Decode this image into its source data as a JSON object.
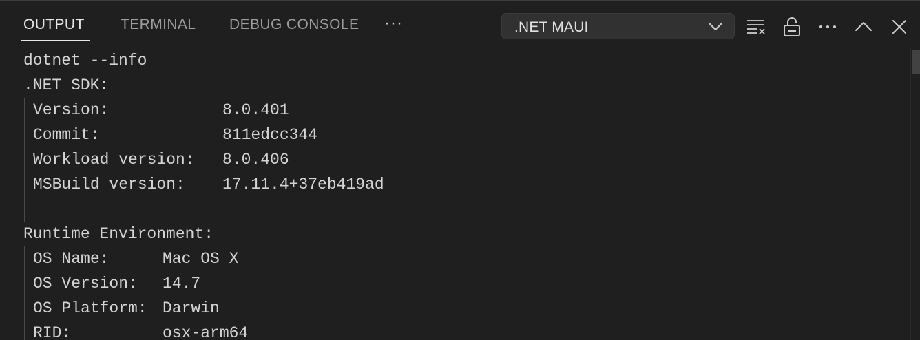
{
  "panel": {
    "tabs": [
      {
        "label": "OUTPUT",
        "active": true
      },
      {
        "label": "TERMINAL",
        "active": false
      },
      {
        "label": "DEBUG CONSOLE",
        "active": false
      }
    ],
    "more_label": "···",
    "channel": ".NET MAUI",
    "actions": {
      "clear_output": "clear-all-icon",
      "lock_scroll": "unlock-icon",
      "more": "ellipsis-icon",
      "maximize": "chevron-up-icon",
      "close": "close-icon"
    }
  },
  "output": {
    "command": "dotnet --info",
    "sdk": {
      "heading": ".NET SDK:",
      "rows": [
        {
          "key": "Version:",
          "value": "8.0.401"
        },
        {
          "key": "Commit:",
          "value": "811edcc344"
        },
        {
          "key": "Workload version:",
          "value": "8.0.406"
        },
        {
          "key": "MSBuild version:",
          "value": "17.11.4+37eb419ad"
        }
      ]
    },
    "runtime": {
      "heading": "Runtime Environment:",
      "rows": [
        {
          "key": "OS Name:",
          "value": "Mac OS X"
        },
        {
          "key": "OS Version:",
          "value": "14.7"
        },
        {
          "key": "OS Platform:",
          "value": "Darwin"
        },
        {
          "key": "RID:",
          "value": "osx-arm64"
        }
      ]
    }
  },
  "colors": {
    "background": "#1f1f1f",
    "text": "#d4d4d4",
    "tab_inactive": "#9d9d9d",
    "tab_active": "#e7e7e7",
    "dropdown_bg": "#313131"
  }
}
